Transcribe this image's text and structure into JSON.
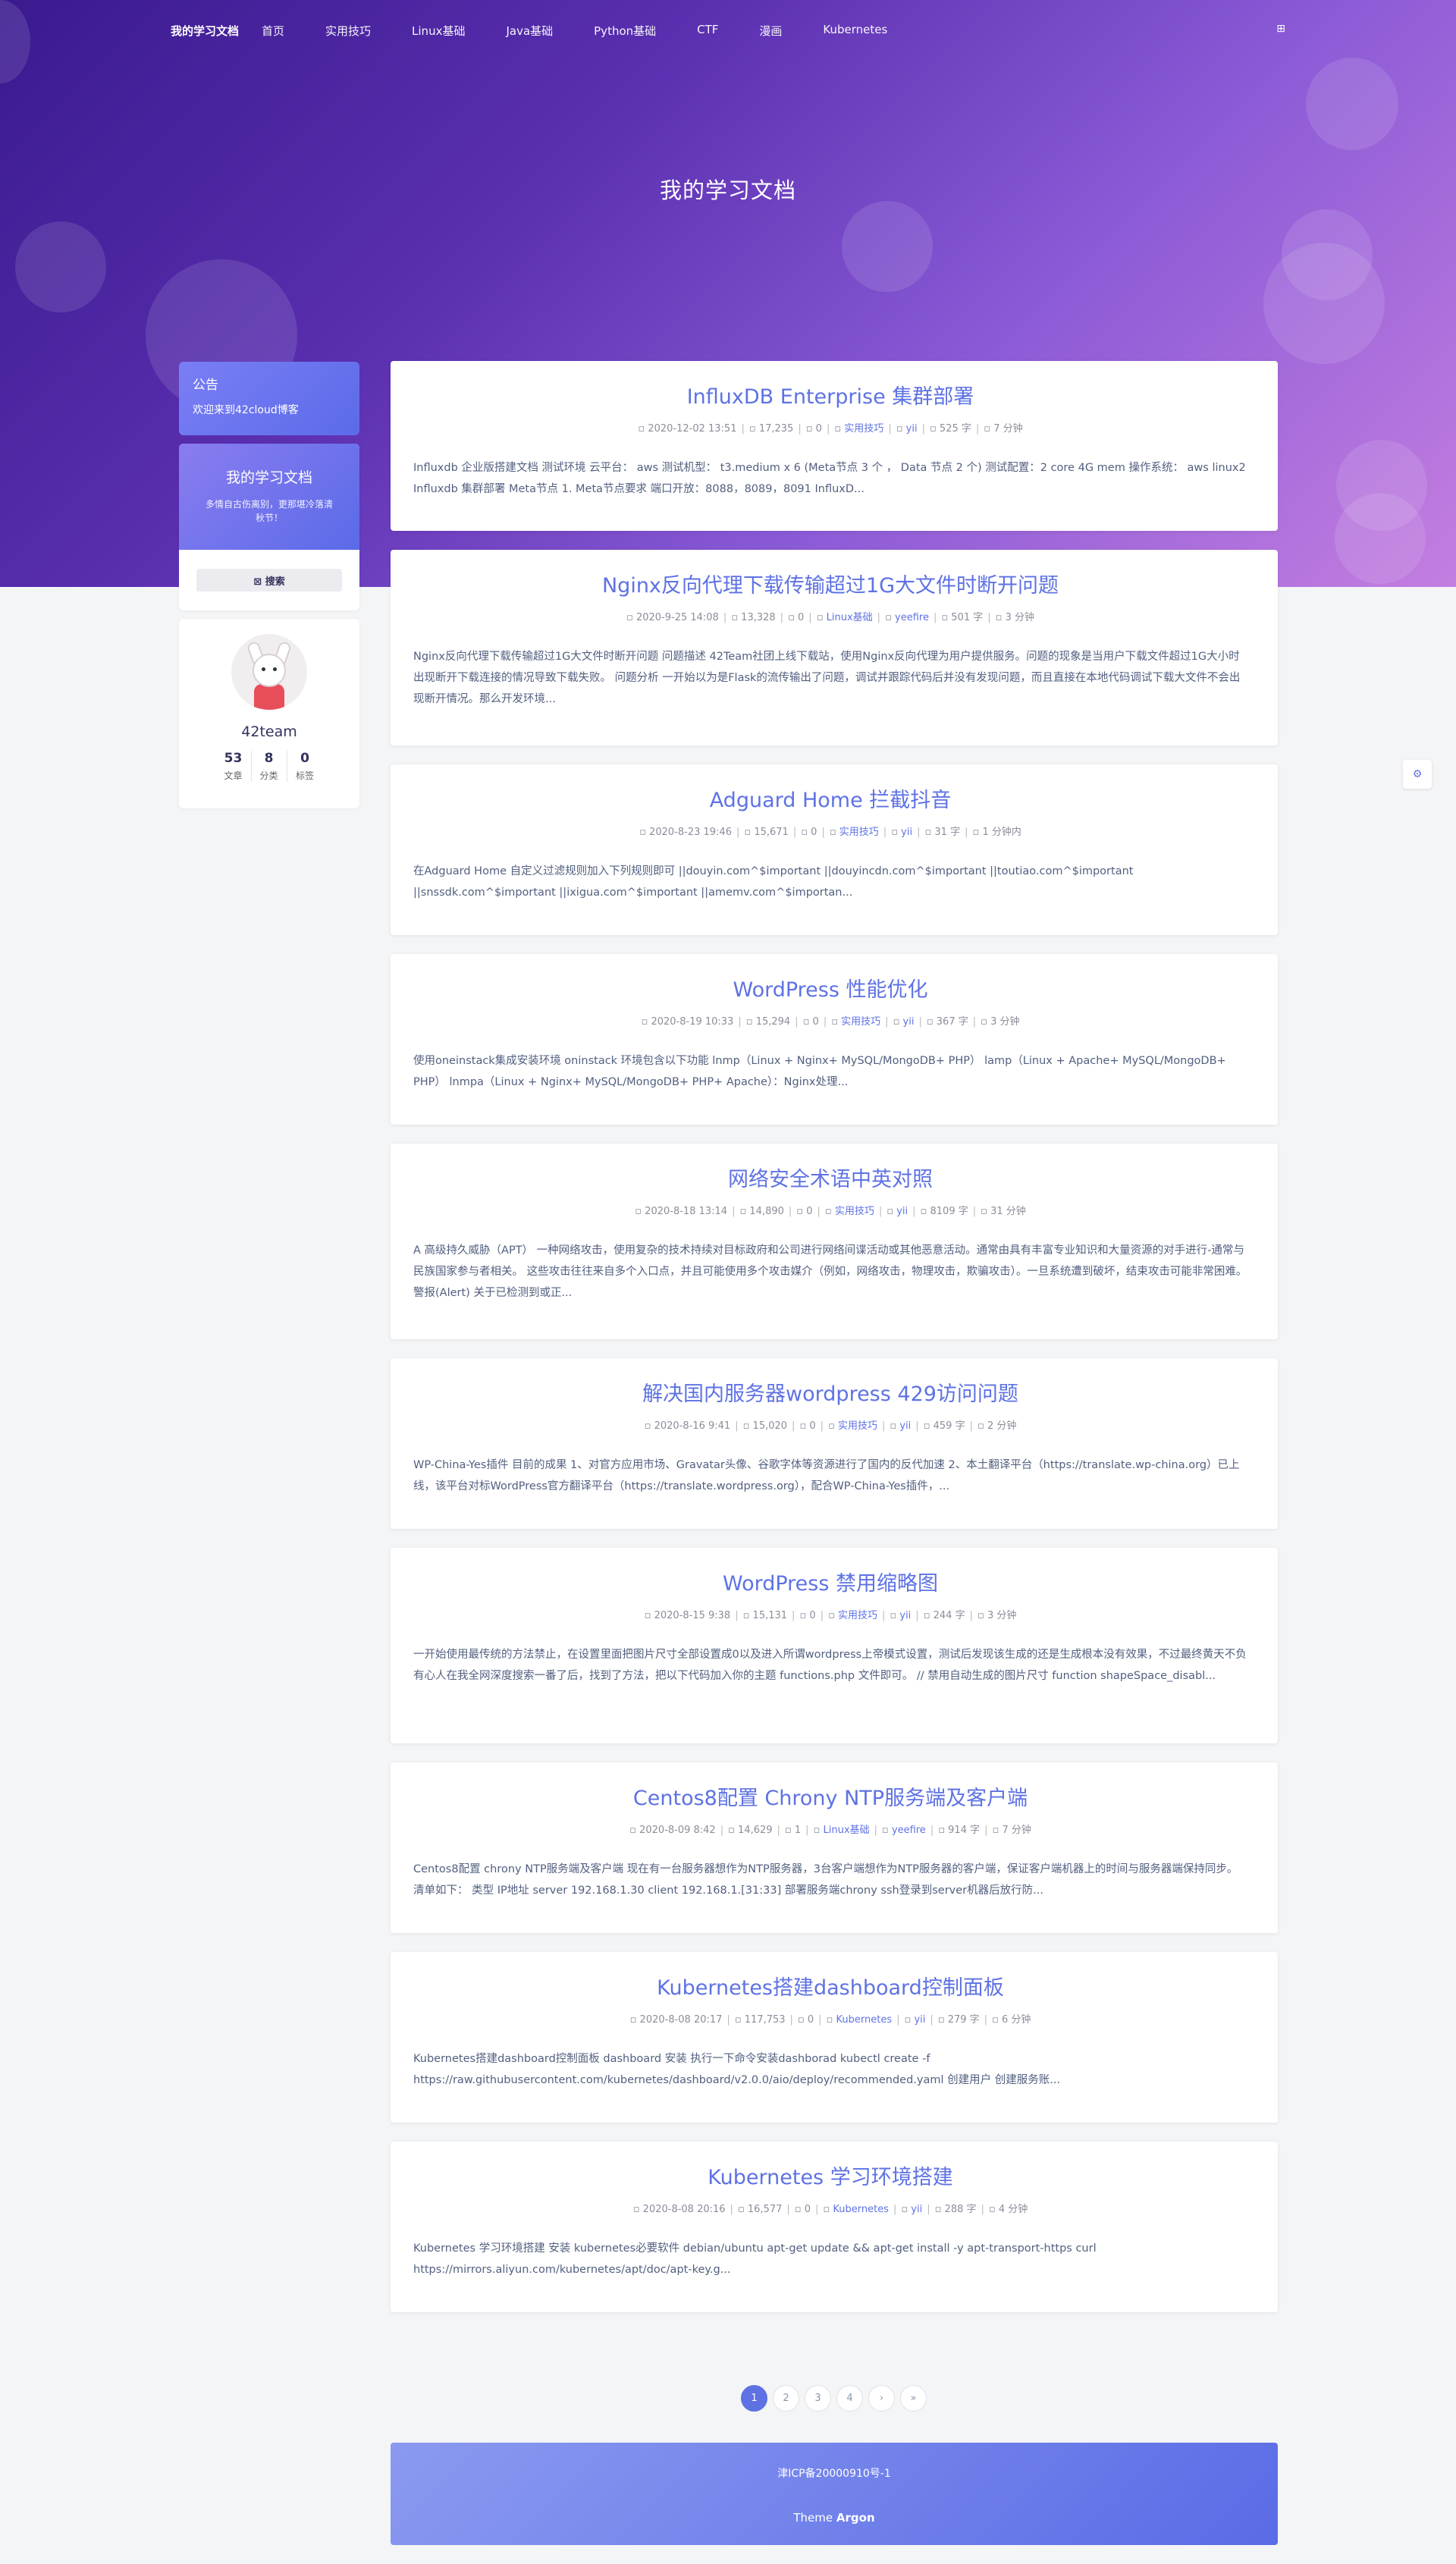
{
  "nav": {
    "brand": "我的学习文档",
    "links": [
      "首页",
      "实用技巧",
      "Linux基础",
      "Java基础",
      "Python基础",
      "CTF",
      "漫画",
      "Kubernetes"
    ],
    "right_icon": "⊞"
  },
  "hero": {
    "title": "我的学习文档"
  },
  "sidebar": {
    "notice_title": "公告",
    "notice_text": "欢迎来到42cloud博客",
    "site_title": "我的学习文档",
    "site_subtitle": "多情自古伤离别，更那堪冷落清秋节！",
    "search_label": "⊠ 搜索",
    "profile_name": "42team",
    "stats": [
      {
        "value": "53",
        "label": "文章"
      },
      {
        "value": "8",
        "label": "分类"
      },
      {
        "value": "0",
        "label": "标签"
      }
    ]
  },
  "posts": [
    {
      "title": "InfluxDB Enterprise 集群部署",
      "date": "2020-12-02 13:51",
      "views": "17,235",
      "comments": "0",
      "category": "实用技巧",
      "author": "yii",
      "words": "525 字",
      "time": "7 分钟",
      "excerpt": "Influxdb 企业版搭建文档 测试环境 云平台： aws 测试机型： t3.medium x 6 (Meta节点 3 个 ， Data 节点 2 个) 测试配置：2 core 4G mem 操作系统： aws linux2 Influxdb 集群部署 Meta节点 1. Meta节点要求 端口开放：8088，8089，8091 InfluxD..."
    },
    {
      "title": "Nginx反向代理下载传输超过1G大文件时断开问题",
      "date": "2020-9-25 14:08",
      "views": "13,328",
      "comments": "0",
      "category": "Linux基础",
      "author": "yeefire",
      "words": "501 字",
      "time": "3 分钟",
      "excerpt": "Nginx反向代理下载传输超过1G大文件时断开问题 问题描述 42Team社团上线下载站，使用Nginx反向代理为用户提供服务。问题的现象是当用户下载文件超过1G大小时出现断开下载连接的情况导致下载失败。 问题分析 一开始以为是Flask的流传输出了问题，调试并跟踪代码后并没有发现问题，而且直接在本地代码调试下载大文件不会出现断开情况。那么开发环境..."
    },
    {
      "title": "Adguard Home 拦截抖音",
      "date": "2020-8-23 19:46",
      "views": "15,671",
      "comments": "0",
      "category": "实用技巧",
      "author": "yii",
      "words": "31 字",
      "time": "1 分钟内",
      "excerpt": "在Adguard Home 自定义过滤规则加入下列规则即可 ||douyin.com^$important ||douyincdn.com^$important ||toutiao.com^$important ||snssdk.com^$important ||ixigua.com^$important ||amemv.com^$importan..."
    },
    {
      "title": "WordPress 性能优化",
      "date": "2020-8-19 10:33",
      "views": "15,294",
      "comments": "0",
      "category": "实用技巧",
      "author": "yii",
      "words": "367 字",
      "time": "3 分钟",
      "excerpt": "使用oneinstack集成安装环境 oninstack 环境包含以下功能 lnmp（Linux + Nginx+ MySQL/MongoDB+ PHP） lamp（Linux + Apache+ MySQL/MongoDB+ PHP） lnmpa（Linux + Nginx+ MySQL/MongoDB+ PHP+ Apache）：Nginx处理..."
    },
    {
      "title": "网络安全术语中英对照",
      "date": "2020-8-18 13:14",
      "views": "14,890",
      "comments": "0",
      "category": "实用技巧",
      "author": "yii",
      "words": "8109 字",
      "time": "31 分钟",
      "excerpt": "A 高级持久威胁（APT） 一种网络攻击，使用复杂的技术持续对目标政府和公司进行网络间谍活动或其他恶意活动。通常由具有丰富专业知识和大量资源的对手进行-通常与民族国家参与者相关。 这些攻击往往来自多个入口点，并且可能使用多个攻击媒介（例如，网络攻击，物理攻击，欺骗攻击）。一旦系统遭到破坏，结束攻击可能非常困难。 警报(Alert) 关于已检测到或正..."
    },
    {
      "title": "解决国内服务器wordpress 429访问问题",
      "date": "2020-8-16 9:41",
      "views": "15,020",
      "comments": "0",
      "category": "实用技巧",
      "author": "yii",
      "words": "459 字",
      "time": "2 分钟",
      "excerpt": "WP-China-Yes插件 目前的成果 1、对官方应用市场、Gravatar头像、谷歌字体等资源进行了国内的反代加速 2、本土翻译平台（https://translate.wp-china.org）已上线，该平台对标WordPress官方翻译平台（https://translate.wordpress.org），配合WP-China-Yes插件，..."
    },
    {
      "title": "WordPress 禁用缩略图",
      "date": "2020-8-15 9:38",
      "views": "15,131",
      "comments": "0",
      "category": "实用技巧",
      "author": "yii",
      "words": "244 字",
      "time": "3 分钟",
      "excerpt": "一开始使用最传统的方法禁止，在设置里面把图片尺寸全部设置成0以及进入所谓wordpress上帝模式设置，测试后发现该生成的还是生成根本没有效果，不过最终黄天不负有心人在我全网深度搜索一番了后，找到了方法，把以下代码加入你的主题 functions.php 文件即可。 // 禁用自动生成的图片尺寸 function shapeSpace_disabl..."
    },
    {
      "title": "Centos8配置 Chrony NTP服务端及客户端",
      "date": "2020-8-09 8:42",
      "views": "14,629",
      "comments": "1",
      "category": "Linux基础",
      "author": "yeefire",
      "words": "914 字",
      "time": "7 分钟",
      "excerpt": "Centos8配置 chrony NTP服务端及客户端 现在有一台服务器想作为NTP服务器，3台客户端想作为NTP服务器的客户端，保证客户端机器上的时间与服务器端保持同步。清单如下： 类型 IP地址 server 192.168.1.30 client 192.168.1.[31:33] 部署服务端chrony ssh登录到server机器后放行防..."
    },
    {
      "title": "Kubernetes搭建dashboard控制面板",
      "date": "2020-8-08 20:17",
      "views": "117,753",
      "comments": "0",
      "category": "Kubernetes",
      "author": "yii",
      "words": "279 字",
      "time": "6 分钟",
      "excerpt": "Kubernetes搭建dashboard控制面板 dashboard 安装 执行一下命令安装dashborad kubectl create -f https://raw.githubusercontent.com/kubernetes/dashboard/v2.0.0/aio/deploy/recommended.yaml 创建用户 创建服务账..."
    },
    {
      "title": "Kubernetes 学习环境搭建",
      "date": "2020-8-08 20:16",
      "views": "16,577",
      "comments": "0",
      "category": "Kubernetes",
      "author": "yii",
      "words": "288 字",
      "time": "4 分钟",
      "excerpt": "Kubernetes 学习环境搭建 安装 kubernetes必要软件 debian/ubuntu apt-get update && apt-get install -y apt-transport-https curl https://mirrors.aliyun.com/kubernetes/apt/doc/apt-key.g..."
    }
  ],
  "pagination": [
    "1",
    "2",
    "3",
    "4",
    "›",
    "»"
  ],
  "footer": {
    "icp": "津ICP备20000910号-1",
    "theme_prefix": "Theme ",
    "theme_name": "Argon"
  },
  "float_icon": "⚙"
}
